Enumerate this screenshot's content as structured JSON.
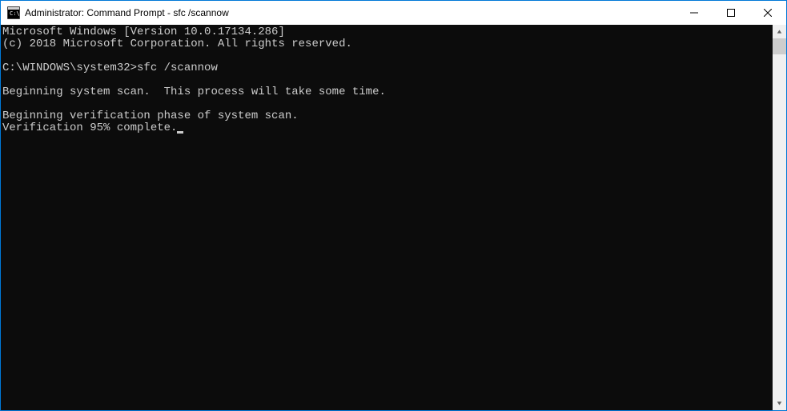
{
  "window": {
    "title": "Administrator: Command Prompt - sfc  /scannow"
  },
  "terminal": {
    "lines": [
      "Microsoft Windows [Version 10.0.17134.286]",
      "(c) 2018 Microsoft Corporation. All rights reserved.",
      "",
      "C:\\WINDOWS\\system32>sfc /scannow",
      "",
      "Beginning system scan.  This process will take some time.",
      "",
      "Beginning verification phase of system scan.",
      "Verification 95% complete."
    ]
  }
}
